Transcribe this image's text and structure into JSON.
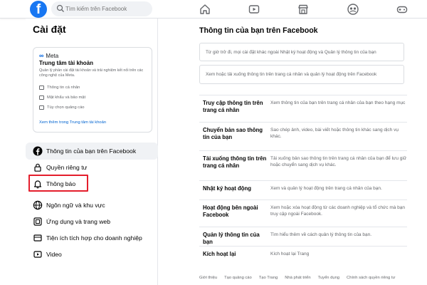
{
  "topbar": {
    "logo": "f",
    "search_placeholder": "Tìm kiếm trên Facebook",
    "nav_icons": [
      "home-icon",
      "watch-icon",
      "marketplace-icon",
      "groups-icon",
      "gaming-icon"
    ]
  },
  "sidebar": {
    "title": "Cài đặt",
    "meta_card": {
      "brand": "Meta",
      "title": "Trung tâm tài khoản",
      "description": "Quản lý phần cài đặt tài khoản và trải nghiệm kết nối trên các công nghệ của Meta.",
      "items": [
        "Thông tin cá nhân",
        "Mật khẩu và bảo mật",
        "Tùy chọn quảng cáo"
      ],
      "link": "Xem thêm trong Trung tâm tài khoản"
    },
    "menu": [
      {
        "label": "Thông tin của bạn trên Facebook",
        "icon": "facebook-circle-icon",
        "active": true
      },
      {
        "label": "Quyền riêng tư",
        "icon": "lock-icon",
        "active": false
      },
      {
        "label": "Thông báo",
        "icon": "bell-icon",
        "active": false
      },
      {
        "label": "Ngôn ngữ và khu vực",
        "icon": "globe-icon",
        "active": false
      },
      {
        "label": "Ứng dụng và trang web",
        "icon": "apps-icon",
        "active": false
      },
      {
        "label": "Tiện ích tích hợp cho doanh nghiệp",
        "icon": "integrations-icon",
        "active": false
      },
      {
        "label": "Video",
        "icon": "video-icon",
        "active": false
      }
    ]
  },
  "main": {
    "title": "Thông tin của bạn trên Facebook",
    "notice1": "Từ giờ trở đi, mọi cài đặt khác ngoài Nhật ký hoạt động và Quản lý thông tin của bạn",
    "notice2": "Xem hoặc tải xuống thông tin trên trang cá nhân và quản lý hoạt động trên Facebook",
    "rows": [
      {
        "label": "Truy cập thông tin trên trang cá nhân",
        "desc": "Xem thông tin của bạn trên trang cá nhân của bạn theo hạng mục"
      },
      {
        "label": "Chuyển bản sao thông tin của bạn",
        "desc": "Sao chép ảnh, video, bài viết hoặc thông tin khác sang dịch vụ khác."
      },
      {
        "label": "Tải xuống thông tin trên trang cá nhân",
        "desc": "Tải xuống bản sao thông tin trên trang cá nhân của bạn để lưu giữ hoặc chuyển sang dịch vụ khác."
      },
      {
        "label": "Nhật ký hoạt động",
        "desc": "Xem và quản lý hoạt động trên trang cá nhân của bạn."
      },
      {
        "label": "Hoạt động bên ngoài Facebook",
        "desc": "Xem hoặc xóa hoạt động từ các doanh nghiệp và tổ chức mà bạn truy cập ngoài Facebook."
      },
      {
        "label": "Quản lý thông tin của bạn",
        "desc": "Tìm hiểu thêm về cách quản lý thông tin của bạn."
      },
      {
        "label": "Kích hoạt lại",
        "desc": "Kích hoạt lại Trang"
      }
    ],
    "footer": [
      "Giới thiệu",
      "Tạo quảng cáo",
      "Tạo Trang",
      "Nhà phát triển",
      "Tuyển dụng",
      "Chính sách quyền riêng tư"
    ]
  }
}
